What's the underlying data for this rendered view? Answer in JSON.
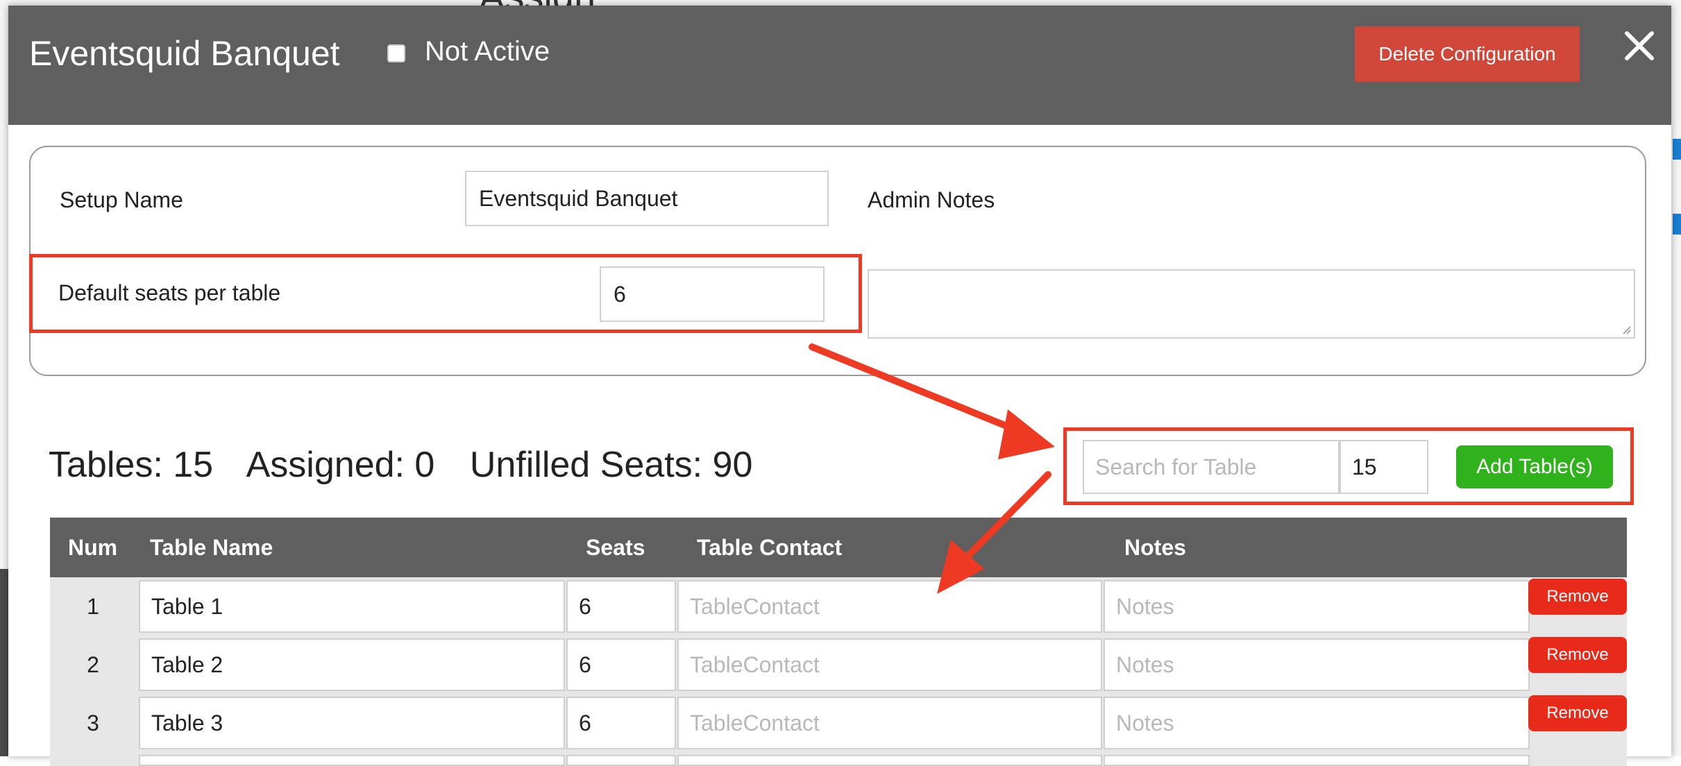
{
  "background": {
    "title_fragment": "Assign:"
  },
  "modal": {
    "title": "Eventsquid Banquet",
    "active_checkbox_label": "Not Active",
    "delete_button": "Delete Configuration",
    "close_icon": "close-icon"
  },
  "setup": {
    "name_label": "Setup Name",
    "name_value": "Eventsquid Banquet",
    "admin_notes_label": "Admin Notes",
    "default_seats_label": "Default seats per table",
    "default_seats_value": "6"
  },
  "stats": {
    "tables": "Tables: 15",
    "assigned": "Assigned: 0",
    "unfilled": "Unfilled Seats: 90"
  },
  "toolbar": {
    "search_placeholder": "Search for Table",
    "count_value": "15",
    "add_button": "Add Table(s)"
  },
  "table": {
    "headers": [
      "Num",
      "Table Name",
      "Seats",
      "Table Contact",
      "Notes"
    ],
    "contact_placeholder": "TableContact",
    "notes_placeholder": "Notes",
    "remove_label": "Remove",
    "rows": [
      {
        "num": "1",
        "name": "Table 1",
        "seats": "6"
      },
      {
        "num": "2",
        "name": "Table 2",
        "seats": "6"
      },
      {
        "num": "3",
        "name": "Table 3",
        "seats": "6"
      }
    ]
  },
  "colors": {
    "header_gray": "#5f5f5f",
    "delete_red": "#d0473a",
    "annotation_red": "#ee3a22",
    "add_green": "#2fb21c",
    "remove_red": "#e82a1a"
  }
}
